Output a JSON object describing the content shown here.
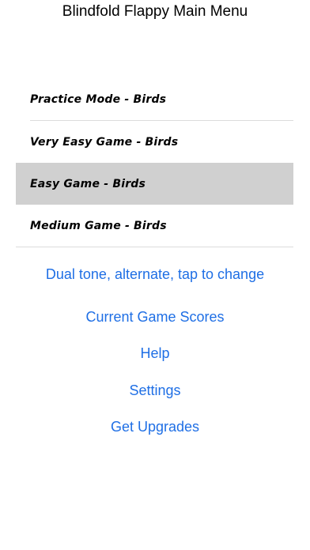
{
  "header": {
    "title": "Blindfold Flappy Main Menu"
  },
  "game_list": {
    "items": [
      {
        "label": "Practice Mode - Birds",
        "selected": false
      },
      {
        "label": "Very Easy Game - Birds",
        "selected": false
      },
      {
        "label": "Easy Game - Birds",
        "selected": true
      },
      {
        "label": "Medium Game - Birds",
        "selected": false
      }
    ]
  },
  "actions": {
    "tone_toggle": "Dual tone, alternate, tap to change",
    "scores": "Current Game Scores",
    "help": "Help",
    "settings": "Settings",
    "upgrades": "Get Upgrades"
  },
  "colors": {
    "link": "#1f6fe5",
    "selected_row": "#d0d0d0",
    "background": "#ffffff"
  }
}
